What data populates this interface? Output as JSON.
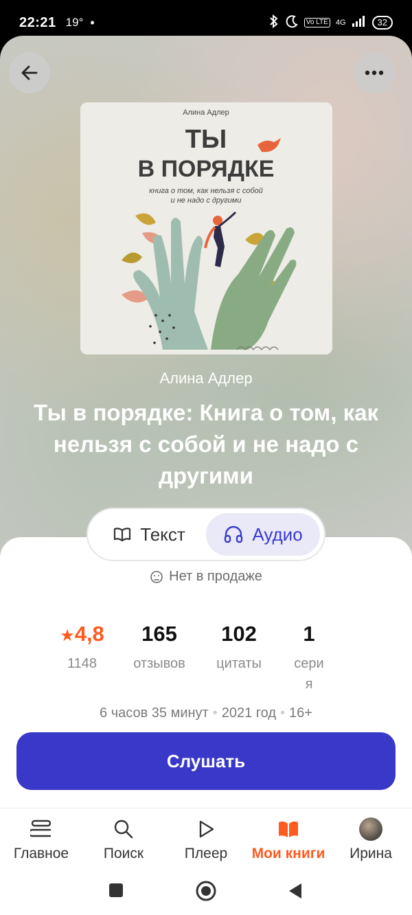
{
  "status": {
    "time": "22:21",
    "temp": "19°",
    "dot": "•",
    "battery": "32",
    "lte": "Vo LTE",
    "net": "4G"
  },
  "book": {
    "author": "Алина Адлер",
    "title": "Ты в порядке: Книга о том, как нельзя с собой и не надо с другими",
    "cover": {
      "author": "Алина Адлер",
      "title_line1": "ТЫ",
      "title_line2": "В ПОРЯДКЕ",
      "subtitle_line1": "книга о том, как нельзя с собой",
      "subtitle_line2": "и не надо с другими"
    }
  },
  "format": {
    "text_label": "Текст",
    "audio_label": "Аудио",
    "selected": "Аудио"
  },
  "sale_status": "Нет в продаже",
  "stats": {
    "rating": "4,8",
    "rating_count": "1148",
    "reviews": "165",
    "reviews_label": "отзывов",
    "quotes": "102",
    "quotes_label": "цитаты",
    "series": "1",
    "series_label_1": "сери",
    "series_label_2": "я"
  },
  "meta": {
    "duration": "6 часов 35 минут",
    "year": "2021 год",
    "age": "16+"
  },
  "listen_label": "Слушать",
  "tabs": [
    {
      "label": "Главное",
      "icon": "layers-icon"
    },
    {
      "label": "Поиск",
      "icon": "search-icon"
    },
    {
      "label": "Плеер",
      "icon": "play-icon"
    },
    {
      "label": "Мои книги",
      "icon": "book-icon",
      "active": true
    },
    {
      "label": "Ирина",
      "icon": "avatar"
    }
  ],
  "colors": {
    "accent": "#3a38c8",
    "brand_orange": "#ff5a1f"
  }
}
